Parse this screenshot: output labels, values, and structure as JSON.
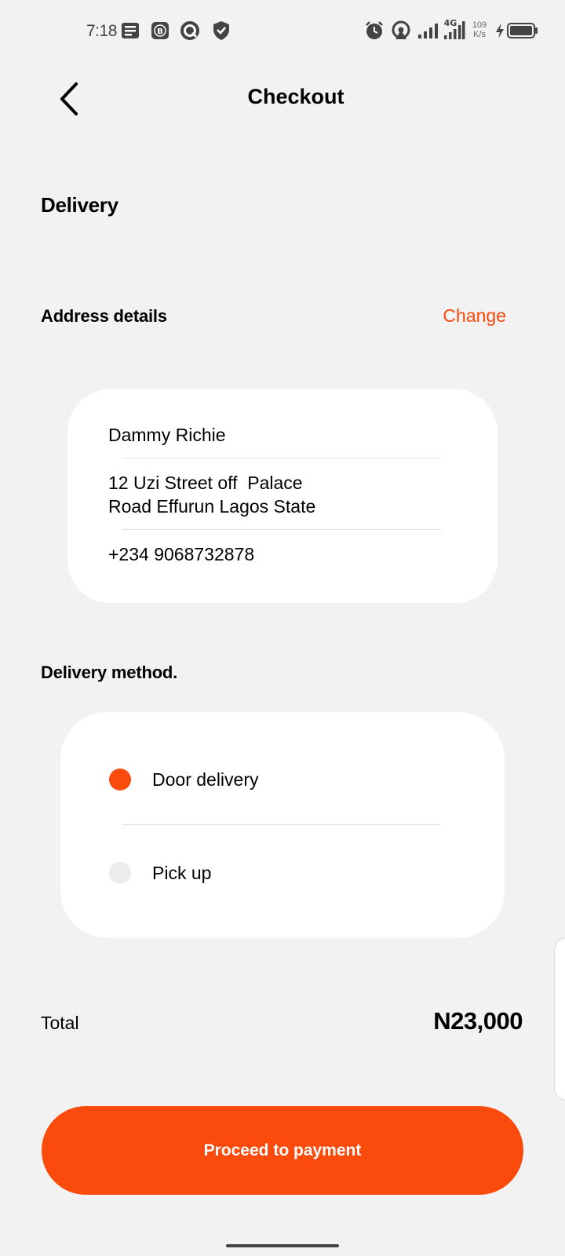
{
  "status_bar": {
    "time": "7:18",
    "network": "4G",
    "speed": "109",
    "speed_unit": "K/s",
    "icons_left": [
      "notes-icon",
      "b-app-icon",
      "q-app-icon",
      "shield-icon"
    ],
    "icons_right": [
      "alarm-icon",
      "hotspot-icon",
      "signal-icon",
      "signal-4g-icon",
      "charging-icon",
      "battery-icon"
    ]
  },
  "header": {
    "title": "Checkout",
    "back_icon": "chevron-left-icon"
  },
  "delivery": {
    "section_title": "Delivery",
    "address_heading": "Address details",
    "change_label": "Change",
    "address": {
      "name": "Dammy Richie",
      "line1": "12 Uzi Street off  Palace",
      "line2": "Road Effurun Lagos State",
      "phone": "+234 9068732878"
    },
    "method_heading": "Delivery method.",
    "methods": [
      {
        "label": "Door delivery",
        "selected": true
      },
      {
        "label": "Pick up",
        "selected": false
      }
    ]
  },
  "total": {
    "label": "Total",
    "value": "N23,000"
  },
  "cta": {
    "label": "Proceed to payment"
  },
  "colors": {
    "accent": "#fa4a0c",
    "background": "#f2f2f2",
    "card": "#ffffff"
  }
}
